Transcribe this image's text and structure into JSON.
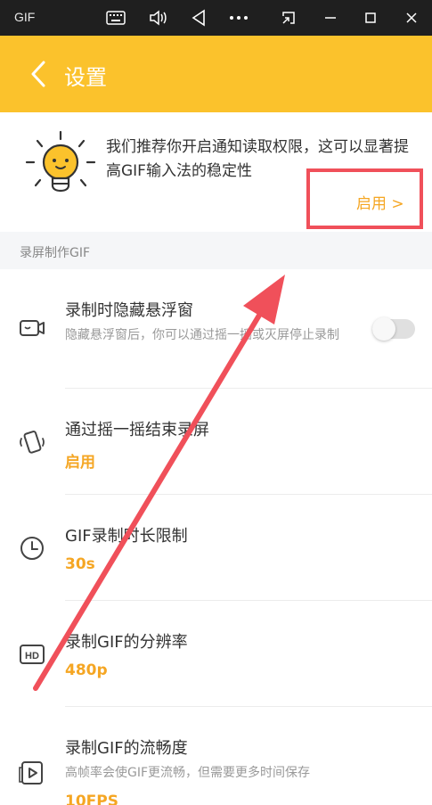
{
  "window": {
    "app_name": "GIF",
    "icons": [
      "keyboard-icon",
      "volume-icon",
      "back-triangle-icon",
      "more-icon",
      "screenshot-icon",
      "minimize-icon",
      "maximize-icon",
      "close-icon"
    ]
  },
  "header": {
    "title": "设置"
  },
  "notice": {
    "text": "我们推荐你开启通知读取权限，这可以显著提高GIF输入法的稳定性",
    "enable_label": "启用 >"
  },
  "section": {
    "label": "录屏制作GIF"
  },
  "rows": [
    {
      "title": "录制时隐藏悬浮窗",
      "subtitle": "隐藏悬浮窗后，你可以通过摇一摇或灭屏停止录制",
      "icon": "record-camera-icon",
      "toggle_on": false
    },
    {
      "title": "通过摇一摇结束录屏",
      "value": "启用",
      "icon": "shake-phone-icon"
    },
    {
      "title": "GIF录制时长限制",
      "value": "30s",
      "icon": "clock-icon"
    },
    {
      "title": "录制GIF的分辨率",
      "value": "480p",
      "icon": "hd-icon"
    },
    {
      "title": "录制GIF的流畅度",
      "subtitle": "高帧率会使GIF更流畅，但需要更多时间保存",
      "value": "10FPS",
      "icon": "play-frames-icon"
    }
  ],
  "colors": {
    "accent": "#FBC22C",
    "value": "#F5A623",
    "annotation": "#F0505A"
  }
}
